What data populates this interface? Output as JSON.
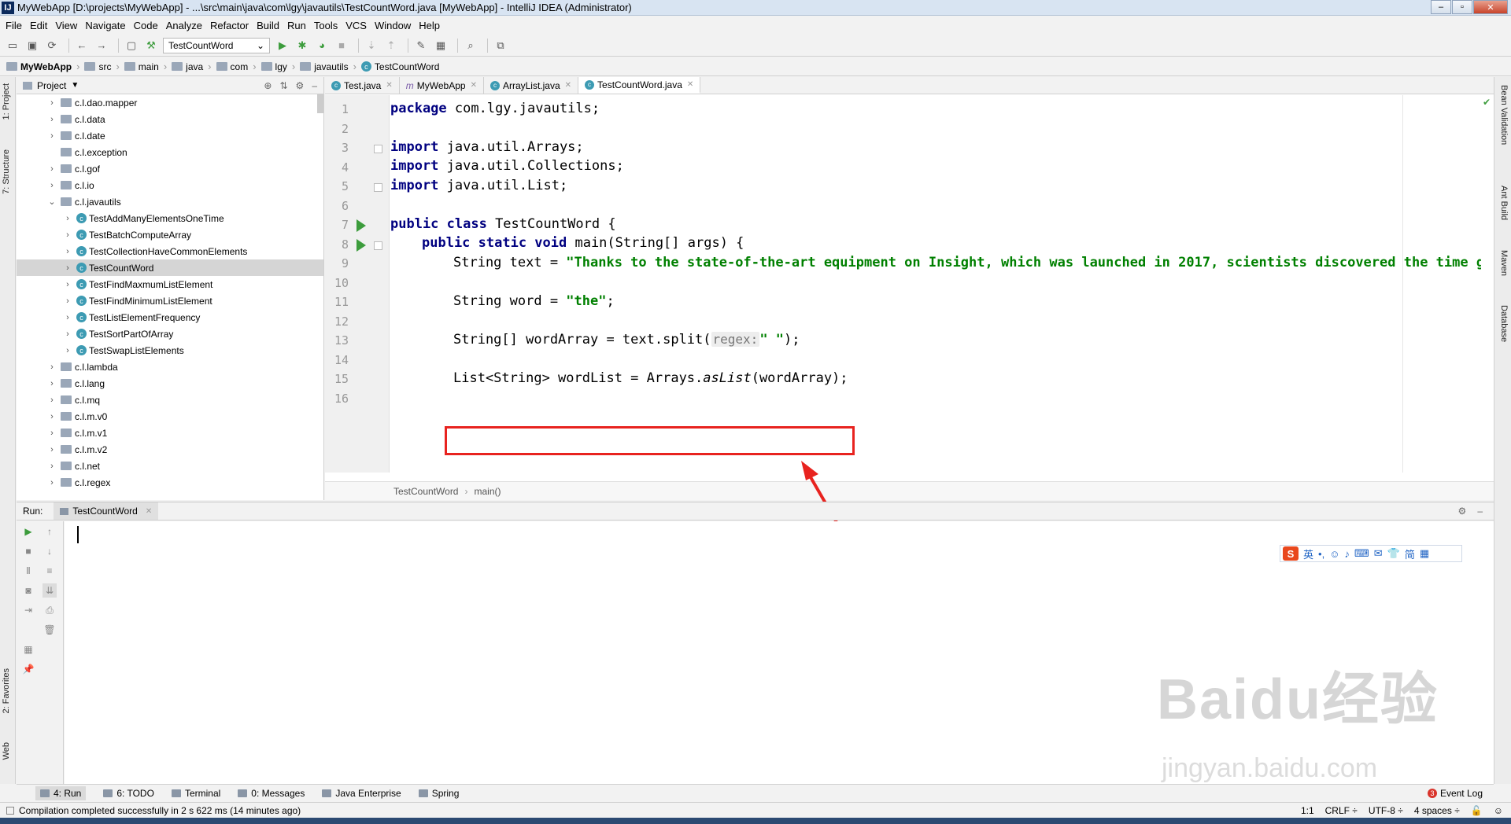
{
  "window": {
    "title": "MyWebApp [D:\\projects\\MyWebApp] - ...\\src\\main\\java\\com\\lgy\\javautils\\TestCountWord.java [MyWebApp] - IntelliJ IDEA (Administrator)",
    "logo": "IJ"
  },
  "menu": [
    "File",
    "Edit",
    "View",
    "Navigate",
    "Code",
    "Analyze",
    "Refactor",
    "Build",
    "Run",
    "Tools",
    "VCS",
    "Window",
    "Help"
  ],
  "toolbar": {
    "run_config": "TestCountWord"
  },
  "nav": [
    "MyWebApp",
    "src",
    "main",
    "java",
    "com",
    "lgy",
    "javautils",
    "TestCountWord"
  ],
  "left_strip": {
    "project": "1: Project",
    "structure": "7: Structure",
    "favorites": "2: Favorites",
    "web": "Web"
  },
  "right_strip": {
    "bean": "Bean Validation",
    "ant": "Ant Build",
    "maven": "Maven",
    "database": "Database"
  },
  "project_pane": {
    "title": "Project",
    "items": [
      {
        "label": "c.l.dao.mapper",
        "kind": "folder",
        "expand": "›",
        "indent": 0
      },
      {
        "label": "c.l.data",
        "kind": "folder",
        "expand": "›",
        "indent": 0
      },
      {
        "label": "c.l.date",
        "kind": "folder",
        "expand": "›",
        "indent": 0
      },
      {
        "label": "c.l.exception",
        "kind": "folder",
        "expand": "",
        "indent": 0
      },
      {
        "label": "c.l.gof",
        "kind": "folder",
        "expand": "›",
        "indent": 0
      },
      {
        "label": "c.l.io",
        "kind": "folder",
        "expand": "›",
        "indent": 0
      },
      {
        "label": "c.l.javautils",
        "kind": "folder",
        "expand": "⌄",
        "indent": 0
      },
      {
        "label": "TestAddManyElementsOneTime",
        "kind": "class",
        "expand": "›",
        "indent": 1
      },
      {
        "label": "TestBatchComputeArray",
        "kind": "class",
        "expand": "›",
        "indent": 1
      },
      {
        "label": "TestCollectionHaveCommonElements",
        "kind": "class",
        "expand": "›",
        "indent": 1
      },
      {
        "label": "TestCountWord",
        "kind": "class",
        "expand": "›",
        "indent": 1,
        "selected": true
      },
      {
        "label": "TestFindMaxmumListElement",
        "kind": "class",
        "expand": "›",
        "indent": 1
      },
      {
        "label": "TestFindMinimumListElement",
        "kind": "class",
        "expand": "›",
        "indent": 1
      },
      {
        "label": "TestListElementFrequency",
        "kind": "class",
        "expand": "›",
        "indent": 1
      },
      {
        "label": "TestSortPartOfArray",
        "kind": "class",
        "expand": "›",
        "indent": 1
      },
      {
        "label": "TestSwapListElements",
        "kind": "class",
        "expand": "›",
        "indent": 1
      },
      {
        "label": "c.l.lambda",
        "kind": "folder",
        "expand": "›",
        "indent": 0
      },
      {
        "label": "c.l.lang",
        "kind": "folder",
        "expand": "›",
        "indent": 0
      },
      {
        "label": "c.l.mq",
        "kind": "folder",
        "expand": "›",
        "indent": 0
      },
      {
        "label": "c.l.m.v0",
        "kind": "folder",
        "expand": "›",
        "indent": 0
      },
      {
        "label": "c.l.m.v1",
        "kind": "folder",
        "expand": "›",
        "indent": 0
      },
      {
        "label": "c.l.m.v2",
        "kind": "folder",
        "expand": "›",
        "indent": 0
      },
      {
        "label": "c.l.net",
        "kind": "folder",
        "expand": "›",
        "indent": 0
      },
      {
        "label": "c.l.regex",
        "kind": "folder",
        "expand": "›",
        "indent": 0
      }
    ]
  },
  "editor_tabs": [
    {
      "label": "Test.java",
      "icon": "class"
    },
    {
      "label": "MyWebApp",
      "icon": "maven"
    },
    {
      "label": "ArrayList.java",
      "icon": "class"
    },
    {
      "label": "TestCountWord.java",
      "icon": "class",
      "active": true
    }
  ],
  "code": {
    "line_numbers": [
      "1",
      "2",
      "3",
      "4",
      "5",
      "6",
      "7",
      "8",
      "9",
      "10",
      "11",
      "12",
      "13",
      "14",
      "15",
      "16"
    ],
    "l1_kw": "package",
    "l1_rest": " com.lgy.javautils;",
    "l3_kw": "import",
    "l3_rest": " java.util.Arrays;",
    "l4_kw": "import",
    "l4_rest": " java.util.Collections;",
    "l5_kw": "import",
    "l5_rest": " java.util.List;",
    "l7_kw": "public class",
    "l7_rest": " TestCountWord {",
    "l8_kw": "public static void",
    "l8_rest": " main(String[] args) {",
    "l9_pre": "String text = ",
    "l9_str": "\"Thanks to the state-of-the-art equipment on Insight, which was launched in 2017, scientists discovered the time gap t",
    "l11_pre": "String word = ",
    "l11_str": "\"the\"",
    "l11_post": ";",
    "l13_pre": "String[] wordArray = text.split(",
    "l13_hint": "regex:",
    "l13_str": "\" \"",
    "l13_post": ");",
    "l15_pre": "List<String> wordList = Arrays.",
    "l15_ital": "asList",
    "l15_post": "(wordArray);"
  },
  "editor_breadcrumb": [
    "TestCountWord",
    "main()"
  ],
  "run_panel": {
    "label": "Run:",
    "tab": "TestCountWord"
  },
  "ime": {
    "logo": "S",
    "mode": "英",
    "items": [
      "•,",
      "☺",
      "♪",
      "⌨",
      "✉",
      "👕",
      "简",
      "▦"
    ]
  },
  "watermark": {
    "main": "Baidu经验",
    "sub": "jingyan.baidu.com"
  },
  "bottom_tabs": [
    {
      "label": "4: Run",
      "active": true
    },
    {
      "label": "6: TODO"
    },
    {
      "label": "Terminal"
    },
    {
      "label": "0: Messages"
    },
    {
      "label": "Java Enterprise"
    },
    {
      "label": "Spring"
    }
  ],
  "event_log": {
    "badge": "3",
    "label": "Event Log"
  },
  "status": {
    "message": "Compilation completed successfully in 2 s 622 ms (14 minutes ago)",
    "position": "1:1",
    "line_sep": "CRLF ÷",
    "encoding": "UTF-8 ÷",
    "indent": "4 spaces ÷"
  },
  "colors": {
    "highlight_box": "#e8231f",
    "keyword": "#000080",
    "string": "#008000",
    "run_gutter": "#3c9c3c"
  }
}
